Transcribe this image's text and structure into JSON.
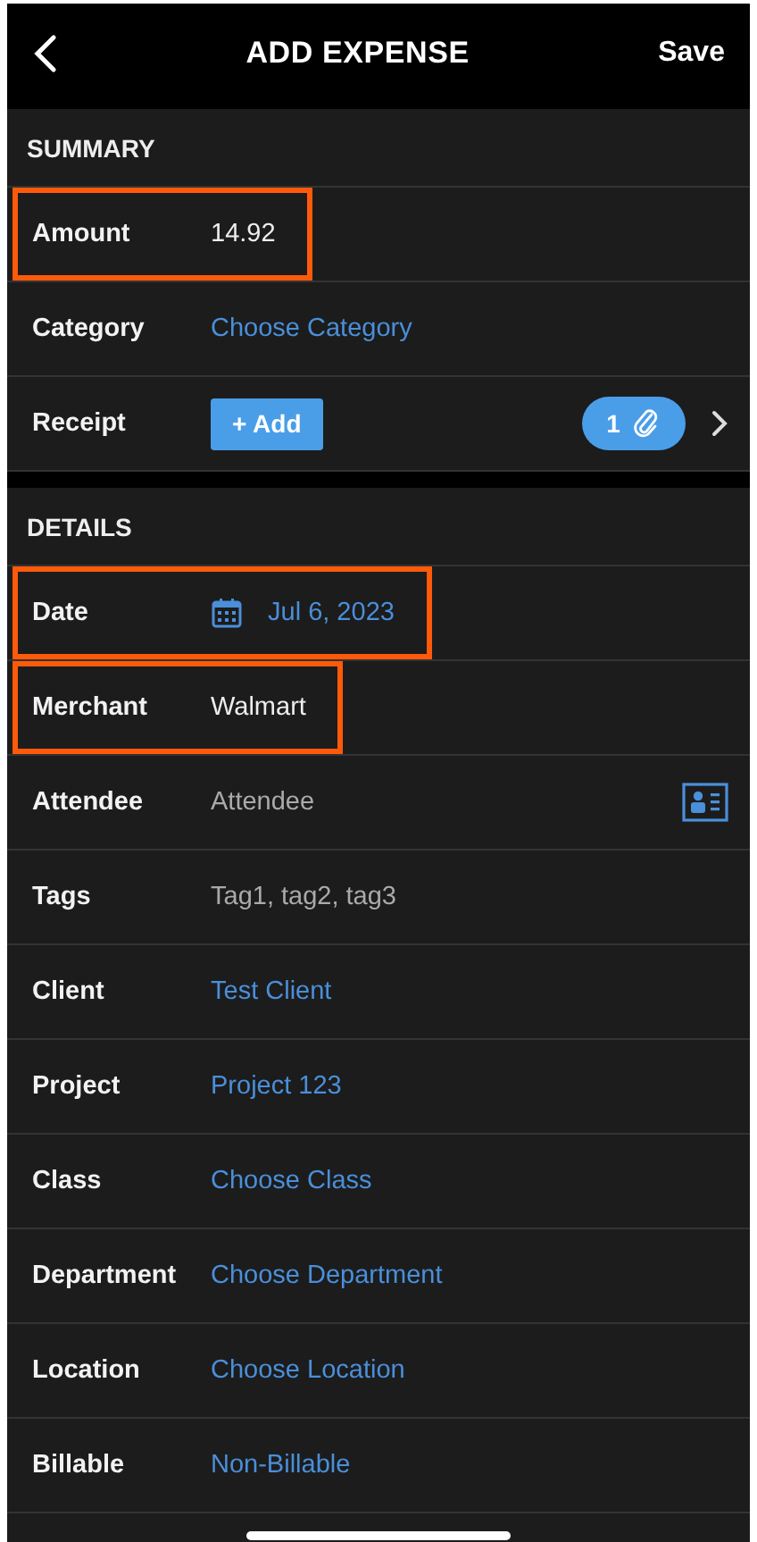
{
  "header": {
    "title": "ADD EXPENSE",
    "action": "Save"
  },
  "sections": [
    {
      "title": "SUMMARY",
      "rows": [
        {
          "kind": "value",
          "label": "Amount",
          "value": "14.92",
          "highlighted": true
        },
        {
          "kind": "link",
          "label": "Category",
          "value": "Choose Category",
          "highlighted": false
        },
        {
          "kind": "receipt",
          "label": "Receipt",
          "button": "+ Add",
          "count": "1",
          "highlighted": false
        }
      ]
    },
    {
      "title": "DETAILS",
      "rows": [
        {
          "kind": "date",
          "label": "Date",
          "value": "Jul 6, 2023",
          "highlighted": true
        },
        {
          "kind": "value",
          "label": "Merchant",
          "value": "Walmart",
          "highlighted": true
        },
        {
          "kind": "attendee",
          "label": "Attendee",
          "placeholder": "Attendee",
          "highlighted": false
        },
        {
          "kind": "placeholder",
          "label": "Tags",
          "placeholder": "Tag1, tag2, tag3",
          "highlighted": false
        },
        {
          "kind": "link",
          "label": "Client",
          "value": "Test Client",
          "highlighted": false
        },
        {
          "kind": "link",
          "label": "Project",
          "value": "Project 123",
          "highlighted": false
        },
        {
          "kind": "link",
          "label": "Class",
          "value": "Choose Class",
          "highlighted": false
        },
        {
          "kind": "link",
          "label": "Department",
          "value": "Choose Department",
          "highlighted": false
        },
        {
          "kind": "link",
          "label": "Location",
          "value": "Choose Location",
          "highlighted": false
        },
        {
          "kind": "link",
          "label": "Billable",
          "value": "Non-Billable",
          "highlighted": false
        }
      ]
    }
  ]
}
